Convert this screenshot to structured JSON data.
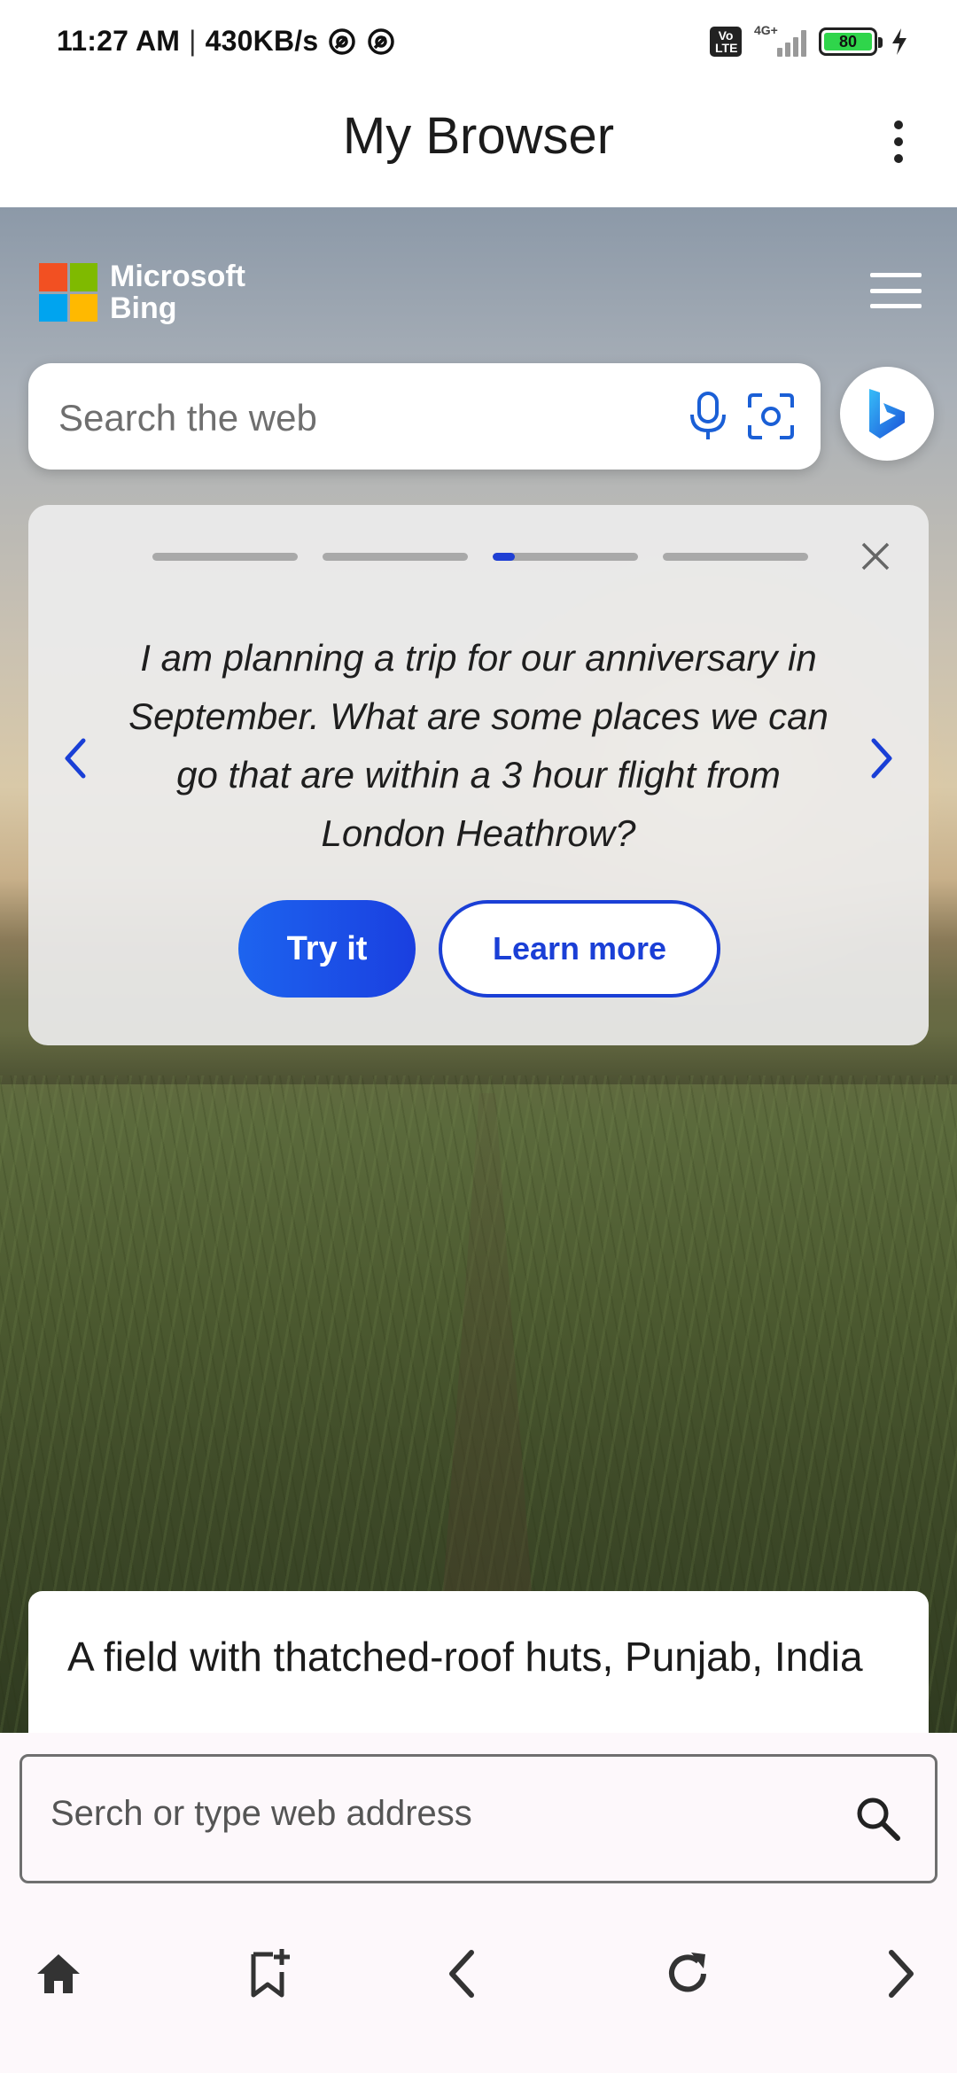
{
  "status_bar": {
    "time": "11:27 AM",
    "separator": "|",
    "speed": "430KB/s",
    "volte_label": "Vo LTE",
    "network_label": "4G+",
    "battery_level": "80",
    "icons": [
      "at-sign-icon",
      "at-sign-icon",
      "volte-icon",
      "signal-icon",
      "battery-icon",
      "charging-icon"
    ]
  },
  "app_bar": {
    "title": "My Browser",
    "menu_icon": "more-vertical-icon"
  },
  "bing": {
    "logo_line1": "Microsoft",
    "logo_line2": "Bing",
    "search_placeholder": "Search the web",
    "menu_icon": "hamburger-icon",
    "mic_icon": "mic-icon",
    "visual_search_icon": "camera-lens-icon",
    "copilot_icon": "bing-b-icon",
    "colors": {
      "ms_red": "#f25022",
      "ms_green": "#7fba00",
      "ms_blue": "#00a4ef",
      "ms_yellow": "#ffb900",
      "accent": "#1a3fd6"
    }
  },
  "carousel": {
    "slide_count": 4,
    "active_slide": 3,
    "active_progress": 0.15,
    "prompt": "I am planning a trip for our anniversary in September. What are some places we can go that are within a 3 hour flight from London Heathrow?",
    "try_label": "Try it",
    "learn_label": "Learn more"
  },
  "image_caption": "A field with thatched-roof huts, Punjab, India",
  "address_bar": {
    "placeholder": "Serch or type web address"
  },
  "bottom_nav": {
    "items": [
      "home-icon",
      "bookmark-add-icon",
      "back-icon",
      "refresh-icon",
      "forward-icon"
    ]
  }
}
